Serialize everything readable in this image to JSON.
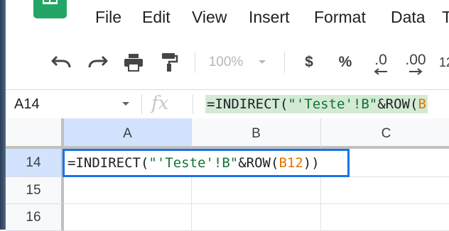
{
  "menu": {
    "items": [
      "File",
      "Edit",
      "View",
      "Insert",
      "Format",
      "Data",
      "T"
    ]
  },
  "toolbar": {
    "undo_icon": "undo-icon",
    "redo_icon": "redo-icon",
    "print_icon": "print-icon",
    "paint_format_icon": "paint-format-icon",
    "zoom": "100%",
    "currency_label": "$",
    "percent_label": "%",
    "decrease_decimal_label": ".0",
    "increase_decimal_label": ".00",
    "more_formats_label": "12"
  },
  "formula_bar": {
    "cell_reference": "A14",
    "fx_label": "fx",
    "formula_parts": {
      "p1": "=INDIRECT(",
      "p2": "\"'Teste'!B\"",
      "p3": "&ROW(",
      "p4": "B"
    }
  },
  "grid": {
    "columns": [
      "A",
      "B",
      "C"
    ],
    "rows": [
      "14",
      "15",
      "16"
    ],
    "active_cell_formula": {
      "p1": "=INDIRECT(",
      "p2": "\"'Teste'!B\"",
      "p3": "&ROW(",
      "p4": "B12",
      "p5": "))"
    }
  },
  "colors": {
    "accent": "#1a73e8",
    "string_token": "#137333",
    "reference_token": "#e37400",
    "formula_highlight": "#d3ead5",
    "selected_header": "#d3e3fd"
  }
}
